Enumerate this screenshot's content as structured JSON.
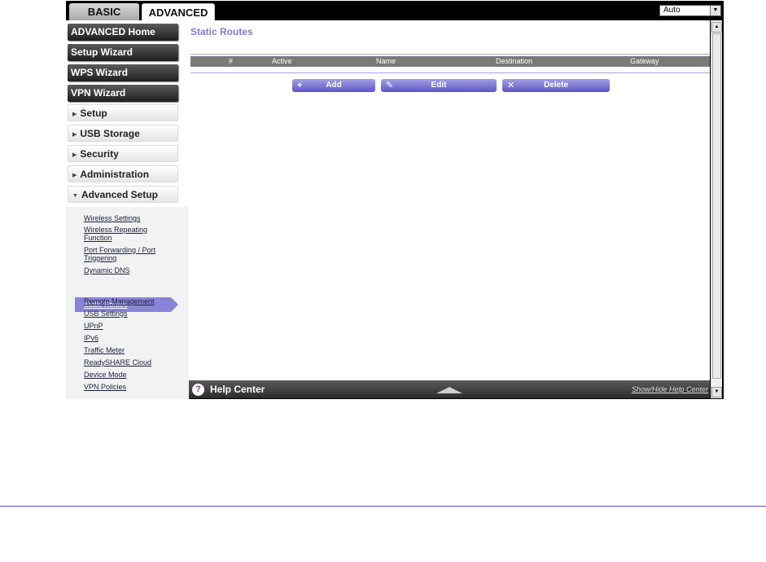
{
  "tabs": [
    {
      "label": "BASIC"
    },
    {
      "label": "ADVANCED"
    }
  ],
  "language_select": {
    "value": "Auto"
  },
  "sidebar": {
    "dark_buttons": [
      {
        "label": "ADVANCED Home"
      },
      {
        "label": "Setup Wizard"
      },
      {
        "label": "WPS Wizard"
      },
      {
        "label": "VPN Wizard"
      }
    ],
    "sections": [
      {
        "label": "Setup",
        "expanded": false
      },
      {
        "label": "USB Storage",
        "expanded": false
      },
      {
        "label": "Security",
        "expanded": false
      },
      {
        "label": "Administration",
        "expanded": false
      },
      {
        "label": "Advanced Setup",
        "expanded": true
      }
    ],
    "submenu": [
      {
        "label": "Wireless Settings"
      },
      {
        "label": "Wireless Repeating Function"
      },
      {
        "label": "Port Forwarding / Port Triggering"
      },
      {
        "label": "Dynamic DNS"
      },
      {
        "label": "Static Routes",
        "active": true
      },
      {
        "label": "Remote Management"
      },
      {
        "label": "USB Settings"
      },
      {
        "label": "UPnP"
      },
      {
        "label": "IPv6"
      },
      {
        "label": "Traffic Meter"
      },
      {
        "label": "ReadySHARE Cloud"
      },
      {
        "label": "Device Mode"
      },
      {
        "label": "VPN Policies"
      }
    ]
  },
  "main": {
    "title": "Static Routes",
    "table": {
      "columns": [
        "#",
        "Active",
        "Name",
        "Destination",
        "Gateway"
      ],
      "rows": []
    },
    "buttons": {
      "add": "Add",
      "edit": "Edit",
      "delete": "Delete"
    }
  },
  "help": {
    "label": "Help Center",
    "show_hide": "Show/Hide Help Center"
  },
  "colors": {
    "accent": "#7f7ad0",
    "button": "#6d67d0",
    "dark_nav": "#2b2b2b"
  }
}
